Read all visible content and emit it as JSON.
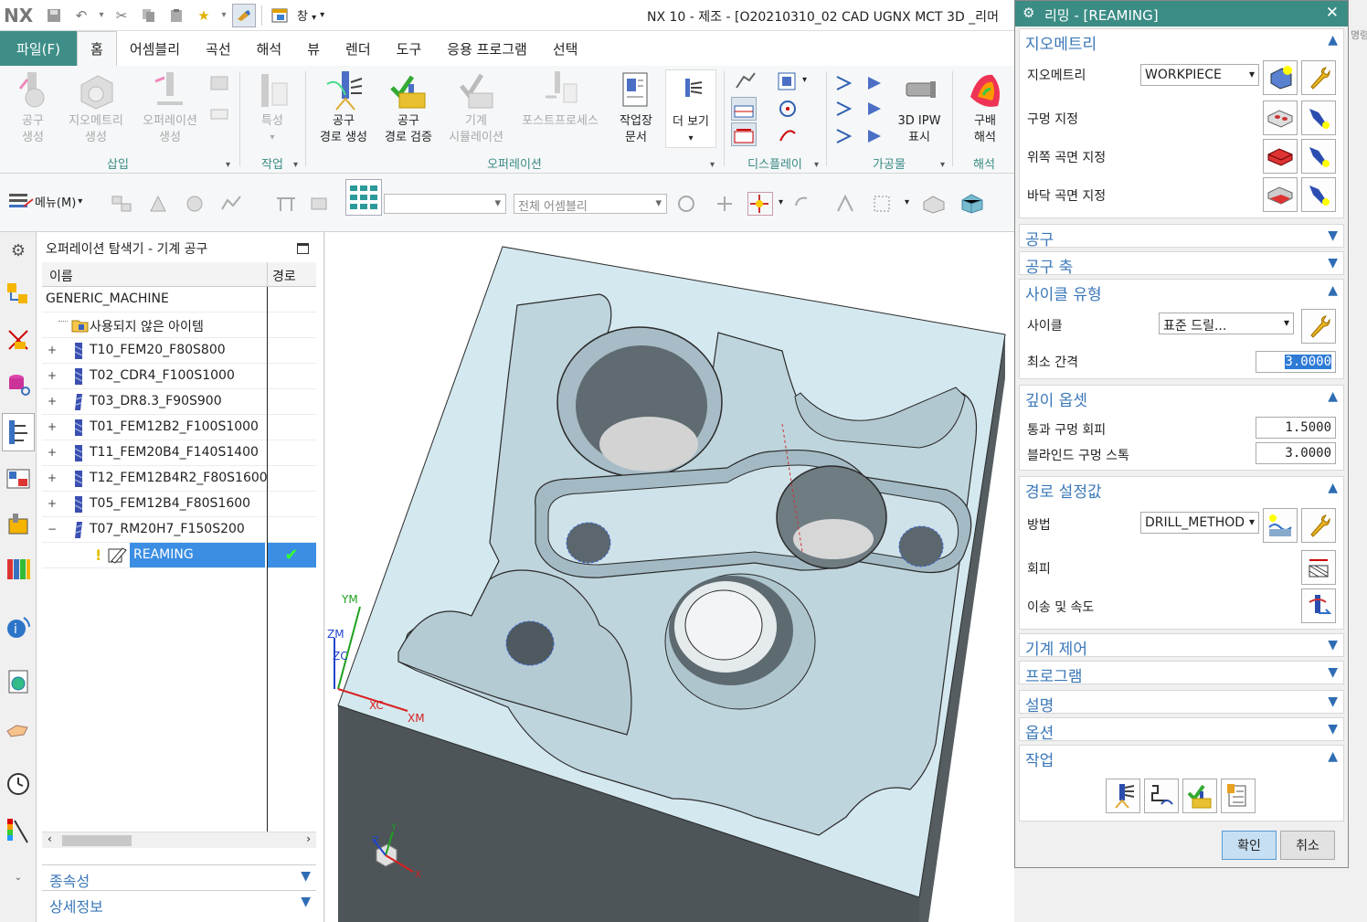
{
  "app": {
    "logo": "NX",
    "window_menu": "창",
    "title": "NX 10 - 제조 - [O20210310_02 CAD UGNX MCT 3D _리머 "
  },
  "ribbon": {
    "file_tab": "파일(F)",
    "tabs": [
      "홈",
      "어셈블리",
      "곡선",
      "해석",
      "뷰",
      "렌더",
      "도구",
      "응용 프로그램",
      "선택"
    ],
    "active_tab": "홈",
    "groups": {
      "insert": {
        "label": "삽입",
        "buttons": [
          "공구\n생성",
          "지오메트리\n생성",
          "오퍼레이션\n생성"
        ]
      },
      "work": {
        "label": "작업",
        "buttons": [
          "특성"
        ]
      },
      "operation": {
        "label": "오퍼레이션",
        "buttons": [
          "공구\n경로 생성",
          "공구\n경로 검증",
          "기계\n시뮬레이션",
          "포스트프로세스",
          "작업장\n문서",
          "더 보기"
        ]
      },
      "display": {
        "label": "디스플레이"
      },
      "workpiece": {
        "label": "가공물",
        "buttons": [
          "3D IPW\n표시"
        ]
      },
      "analysis": {
        "label": "해석",
        "buttons": [
          "구배\n해석"
        ]
      }
    }
  },
  "toolbar2": {
    "menu_label": "메뉴(M)",
    "combo_empty": "",
    "combo_assembly": "전체 어셈블리"
  },
  "navigator": {
    "title": "오퍼레이션 탐색기 - 기계 공구",
    "col_name": "이름",
    "col_path": "경로",
    "rows": [
      {
        "label": "GENERIC_MACHINE",
        "type": "root"
      },
      {
        "label": "사용되지 않은 아이템",
        "type": "folder"
      },
      {
        "label": "T10_FEM20_F80S800",
        "type": "tool"
      },
      {
        "label": "T02_CDR4_F100S1000",
        "type": "tool"
      },
      {
        "label": "T03_DR8.3_F90S900",
        "type": "tool"
      },
      {
        "label": "T01_FEM12B2_F100S1000",
        "type": "tool"
      },
      {
        "label": "T11_FEM20B4_F140S1400",
        "type": "tool"
      },
      {
        "label": "T12_FEM12B4R2_F80S1600",
        "type": "tool"
      },
      {
        "label": "T05_FEM12B4_F80S1600",
        "type": "tool"
      },
      {
        "label": "T07_RM20H7_F150S200",
        "type": "tool-open"
      },
      {
        "label": "REAMING",
        "type": "operation",
        "path_status": "✔"
      }
    ],
    "bottom_sections": [
      "종속성",
      "상세정보"
    ]
  },
  "viewport": {
    "axis_ym": "YM",
    "axis_zm": "ZM",
    "axis_zc": "ZC",
    "axis_xc": "XC",
    "axis_xm": "XM",
    "triad_y": "Y",
    "triad_z": "Z",
    "triad_x": "X"
  },
  "dialog": {
    "title": "리밍 - [REAMING]",
    "geometry": {
      "header": "지오메트리",
      "geometry_label": "지오메트리",
      "geometry_value": "WORKPIECE",
      "hole_label": "구멍 지정",
      "top_label": "위쪽 곡면 지정",
      "bottom_label": "바닥 곡면 지정"
    },
    "tool": {
      "header": "공구"
    },
    "tool_axis": {
      "header": "공구 축"
    },
    "cycle_type": {
      "header": "사이클 유형",
      "cycle_label": "사이클",
      "cycle_value": "표준 드릴...",
      "min_clearance_label": "최소 간격",
      "min_clearance_value": "3.0000"
    },
    "depth_offset": {
      "header": "깊이 옵셋",
      "through_label": "통과 구멍 회피",
      "through_value": "1.5000",
      "blind_label": "블라인드 구멍 스톡",
      "blind_value": "3.0000"
    },
    "path_settings": {
      "header": "경로 설정값",
      "method_label": "방법",
      "method_value": "DRILL_METHOD",
      "avoid_label": "회피",
      "feeds_label": "이송 및 속도"
    },
    "machine_control": {
      "header": "기계 제어"
    },
    "program": {
      "header": "프로그램"
    },
    "description": {
      "header": "설명"
    },
    "options": {
      "header": "옵션"
    },
    "actions": {
      "header": "작업"
    },
    "ok_label": "확인",
    "cancel_label": "취소"
  },
  "partial_right_text": "명령"
}
